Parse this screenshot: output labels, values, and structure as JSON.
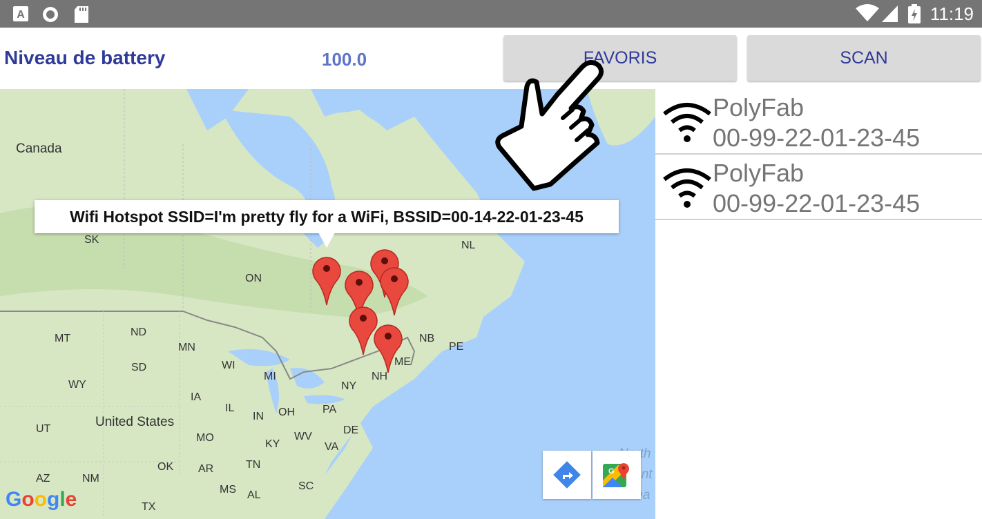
{
  "status_bar": {
    "time": "11:19",
    "left_icons": [
      "text-a-icon",
      "record-icon",
      "sd-card-icon"
    ],
    "right_icons": [
      "wifi-signal-icon",
      "cell-signal-icon",
      "battery-charging-icon"
    ]
  },
  "header": {
    "battery_label": "Niveau de battery",
    "battery_value": "100.0",
    "favoris_label": "FAVORIS",
    "scan_label": "SCAN"
  },
  "map": {
    "labels": {
      "canada": "Canada",
      "sk": "SK",
      "on": "ON",
      "nl": "NL",
      "mt": "MT",
      "nd": "ND",
      "mn": "MN",
      "wi": "WI",
      "mi": "MI",
      "sd": "SD",
      "wy": "WY",
      "ia": "IA",
      "il": "IL",
      "in": "IN",
      "oh": "OH",
      "pa": "PA",
      "ny": "NY",
      "nh": "NH",
      "me": "ME",
      "nb": "NB",
      "pe": "PE",
      "united_states": "United States",
      "ut": "UT",
      "mo": "MO",
      "ky": "KY",
      "wv": "WV",
      "de": "DE",
      "va": "VA",
      "tn": "TN",
      "ok": "OK",
      "ar": "AR",
      "az": "AZ",
      "nm": "NM",
      "ms": "MS",
      "al": "AL",
      "sc": "SC",
      "tx": "TX",
      "ocean_1": "North",
      "ocean_2": "Atlant",
      "ocean_3": "Ocea"
    },
    "infowindow_text": "Wifi Hotspot SSID=I'm pretty fly for a WiFi, BSSID=00-14-22-01-23-45",
    "marker_count": 6,
    "google_logo": [
      "G",
      "o",
      "o",
      "g",
      "l",
      "e"
    ],
    "colors": {
      "water": "#a9d0fb",
      "land": "#d7e7c3",
      "marker": "#e8483d"
    }
  },
  "wifi_list": [
    {
      "ssid": "PolyFab",
      "bssid": "00-99-22-01-23-45"
    },
    {
      "ssid": "PolyFab",
      "bssid": "00-99-22-01-23-45"
    }
  ]
}
